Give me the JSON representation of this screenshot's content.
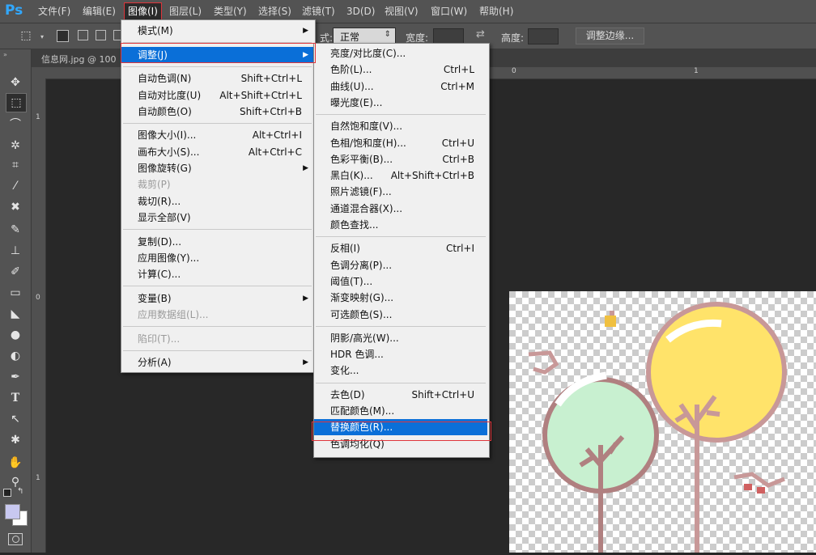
{
  "app": {
    "logo": "Ps"
  },
  "menubar": [
    {
      "label": "文件(F)",
      "active": false
    },
    {
      "label": "编辑(E)",
      "active": false
    },
    {
      "label": "图像(I)",
      "active": true
    },
    {
      "label": "图层(L)",
      "active": false
    },
    {
      "label": "类型(Y)",
      "active": false
    },
    {
      "label": "选择(S)",
      "active": false
    },
    {
      "label": "滤镜(T)",
      "active": false
    },
    {
      "label": "3D(D)",
      "active": false
    },
    {
      "label": "视图(V)",
      "active": false
    },
    {
      "label": "窗口(W)",
      "active": false
    },
    {
      "label": "帮助(H)",
      "active": false
    }
  ],
  "options": {
    "style_suffix": "式:",
    "style_value": "正常",
    "width_label": "宽度:",
    "height_label": "高度:",
    "refine_edge": "调整边缘..."
  },
  "document": {
    "tab_label": "信息网.jpg @ 100"
  },
  "rulers": {
    "top": [
      "0",
      "1"
    ],
    "left": [
      "1",
      "0",
      "1"
    ]
  },
  "image_menu": [
    {
      "label": "模式(M)",
      "shortcut": "",
      "submenu": true,
      "disabled": false,
      "sep_after": true
    },
    {
      "label": "调整(J)",
      "shortcut": "",
      "submenu": true,
      "disabled": false,
      "highlighted": true,
      "sep_after": true
    },
    {
      "label": "自动色调(N)",
      "shortcut": "Shift+Ctrl+L",
      "submenu": false,
      "disabled": false
    },
    {
      "label": "自动对比度(U)",
      "shortcut": "Alt+Shift+Ctrl+L",
      "submenu": false,
      "disabled": false
    },
    {
      "label": "自动颜色(O)",
      "shortcut": "Shift+Ctrl+B",
      "submenu": false,
      "disabled": false,
      "sep_after": true
    },
    {
      "label": "图像大小(I)...",
      "shortcut": "Alt+Ctrl+I",
      "submenu": false,
      "disabled": false
    },
    {
      "label": "画布大小(S)...",
      "shortcut": "Alt+Ctrl+C",
      "submenu": false,
      "disabled": false
    },
    {
      "label": "图像旋转(G)",
      "shortcut": "",
      "submenu": true,
      "disabled": false
    },
    {
      "label": "裁剪(P)",
      "shortcut": "",
      "submenu": false,
      "disabled": true
    },
    {
      "label": "裁切(R)...",
      "shortcut": "",
      "submenu": false,
      "disabled": false
    },
    {
      "label": "显示全部(V)",
      "shortcut": "",
      "submenu": false,
      "disabled": false,
      "sep_after": true
    },
    {
      "label": "复制(D)...",
      "shortcut": "",
      "submenu": false,
      "disabled": false
    },
    {
      "label": "应用图像(Y)...",
      "shortcut": "",
      "submenu": false,
      "disabled": false
    },
    {
      "label": "计算(C)...",
      "shortcut": "",
      "submenu": false,
      "disabled": false,
      "sep_after": true
    },
    {
      "label": "变量(B)",
      "shortcut": "",
      "submenu": true,
      "disabled": false
    },
    {
      "label": "应用数据组(L)...",
      "shortcut": "",
      "submenu": false,
      "disabled": true,
      "sep_after": true
    },
    {
      "label": "陷印(T)...",
      "shortcut": "",
      "submenu": false,
      "disabled": true,
      "sep_after": true
    },
    {
      "label": "分析(A)",
      "shortcut": "",
      "submenu": true,
      "disabled": false
    }
  ],
  "adjust_menu": [
    {
      "label": "亮度/对比度(C)...",
      "shortcut": ""
    },
    {
      "label": "色阶(L)...",
      "shortcut": "Ctrl+L"
    },
    {
      "label": "曲线(U)...",
      "shortcut": "Ctrl+M"
    },
    {
      "label": "曝光度(E)...",
      "shortcut": "",
      "sep_after": true
    },
    {
      "label": "自然饱和度(V)...",
      "shortcut": ""
    },
    {
      "label": "色相/饱和度(H)...",
      "shortcut": "Ctrl+U"
    },
    {
      "label": "色彩平衡(B)...",
      "shortcut": "Ctrl+B"
    },
    {
      "label": "黑白(K)...",
      "shortcut": "Alt+Shift+Ctrl+B"
    },
    {
      "label": "照片滤镜(F)...",
      "shortcut": ""
    },
    {
      "label": "通道混合器(X)...",
      "shortcut": ""
    },
    {
      "label": "颜色查找...",
      "shortcut": "",
      "sep_after": true
    },
    {
      "label": "反相(I)",
      "shortcut": "Ctrl+I"
    },
    {
      "label": "色调分离(P)...",
      "shortcut": ""
    },
    {
      "label": "阈值(T)...",
      "shortcut": ""
    },
    {
      "label": "渐变映射(G)...",
      "shortcut": ""
    },
    {
      "label": "可选颜色(S)...",
      "shortcut": "",
      "sep_after": true
    },
    {
      "label": "阴影/高光(W)...",
      "shortcut": ""
    },
    {
      "label": "HDR 色调...",
      "shortcut": ""
    },
    {
      "label": "变化...",
      "shortcut": "",
      "sep_after": true
    },
    {
      "label": "去色(D)",
      "shortcut": "Shift+Ctrl+U"
    },
    {
      "label": "匹配颜色(M)...",
      "shortcut": ""
    },
    {
      "label": "替换颜色(R)...",
      "shortcut": "",
      "highlighted": true
    },
    {
      "label": "色调均化(Q)",
      "shortcut": ""
    }
  ],
  "colors": {
    "menu_highlight": "#0a6fd8",
    "annotation_red": "#e0353b",
    "ui_panel": "#535353",
    "workspace": "#282828",
    "tree_green": "#c8f0d0",
    "tree_yellow": "#ffe36a",
    "tree_outline": "#b08080"
  },
  "tools": [
    "move-icon",
    "marquee-icon",
    "lasso-icon",
    "magic-wand-icon",
    "crop-icon",
    "eyedropper-icon",
    "healing-icon",
    "brush-icon",
    "stamp-icon",
    "history-brush-icon",
    "eraser-icon",
    "paint-bucket-icon",
    "blur-icon",
    "dodge-icon",
    "pen-icon",
    "type-icon",
    "path-select-icon",
    "shape-icon",
    "hand-icon",
    "zoom-icon"
  ]
}
